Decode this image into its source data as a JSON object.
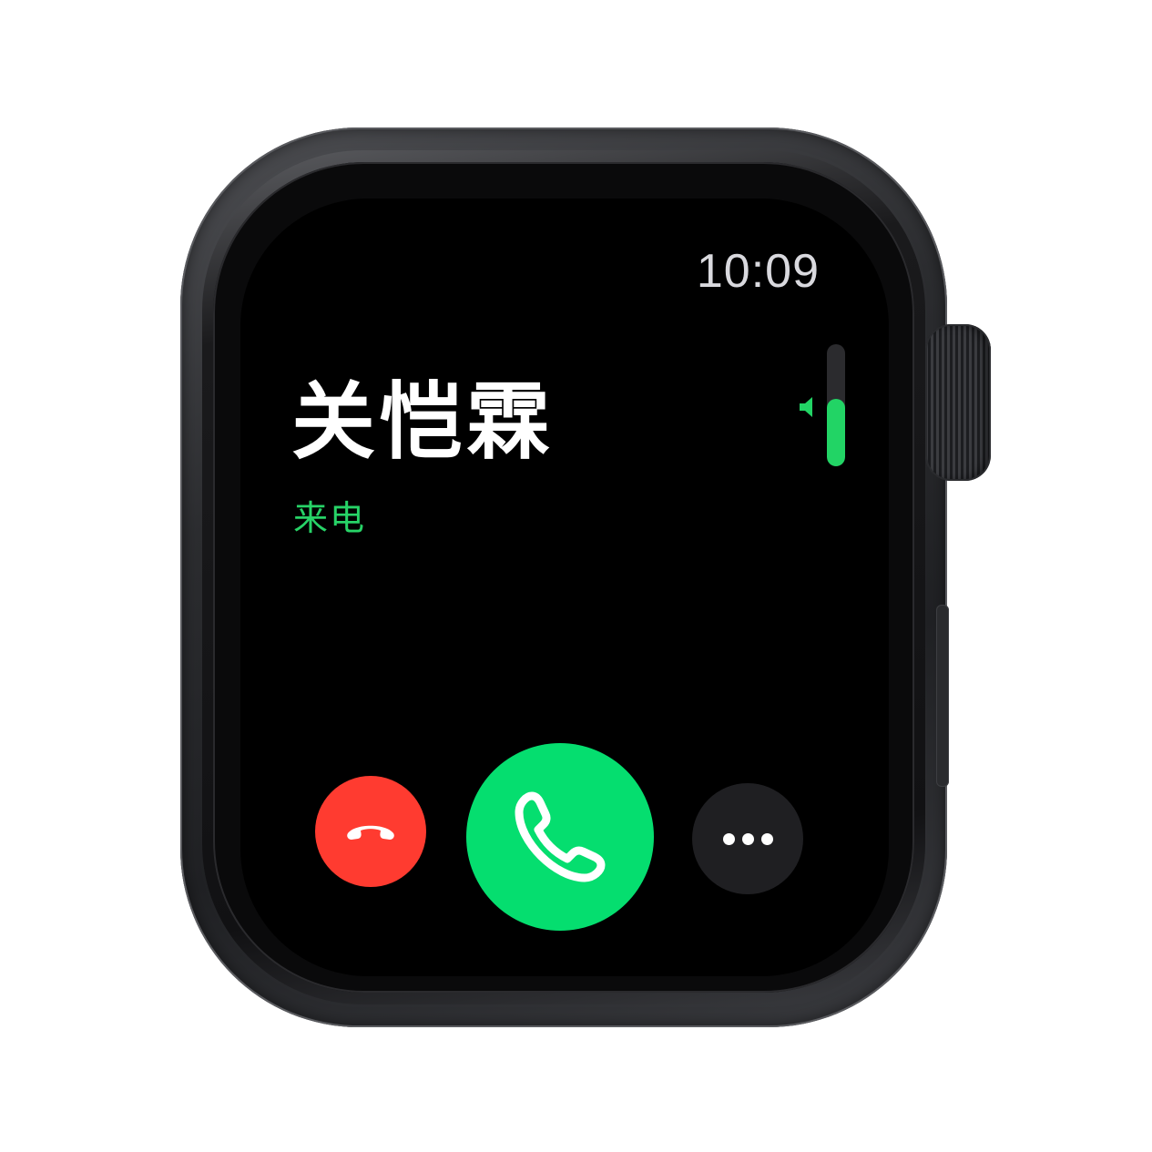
{
  "status_bar": {
    "time": "10:09"
  },
  "call": {
    "caller_name": "关恺霖",
    "status": "来电"
  },
  "volume": {
    "level": 0.55
  },
  "actions": {
    "decline_icon": "phone-hangup-icon",
    "accept_icon": "phone-icon",
    "more_icon": "ellipsis-icon"
  },
  "colors": {
    "screen_bg": "#000000",
    "accent_green": "#05de6f",
    "status_green": "#27d367",
    "decline_red": "#ff3b30",
    "more_bg": "#1f1f22",
    "clock_text": "#d9d9de"
  }
}
